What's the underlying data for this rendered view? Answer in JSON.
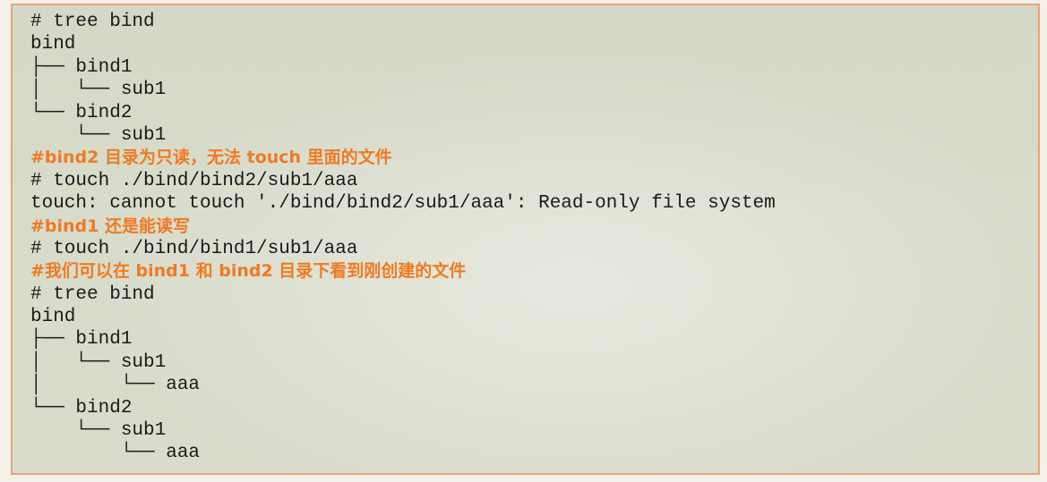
{
  "code_block": {
    "lines": [
      {
        "text": "# tree bind",
        "type": "command"
      },
      {
        "text": "bind",
        "type": "output"
      },
      {
        "text": "├── bind1",
        "type": "output"
      },
      {
        "text": "│   └── sub1",
        "type": "output"
      },
      {
        "text": "└── bind2",
        "type": "output"
      },
      {
        "text": "    └── sub1",
        "type": "output"
      },
      {
        "text": "#bind2 目录为只读，无法 touch 里面的文件",
        "type": "comment"
      },
      {
        "text": "# touch ./bind/bind2/sub1/aaa",
        "type": "command"
      },
      {
        "text": "touch: cannot touch './bind/bind2/sub1/aaa': Read-only file system",
        "type": "output"
      },
      {
        "text": "#bind1 还是能读写",
        "type": "comment"
      },
      {
        "text": "# touch ./bind/bind1/sub1/aaa",
        "type": "command"
      },
      {
        "text": "#我们可以在 bind1 和 bind2 目录下看到刚创建的文件",
        "type": "comment"
      },
      {
        "text": "# tree bind",
        "type": "command"
      },
      {
        "text": "bind",
        "type": "output"
      },
      {
        "text": "├── bind1",
        "type": "output"
      },
      {
        "text": "│   └── sub1",
        "type": "output"
      },
      {
        "text": "│       └── aaa",
        "type": "output"
      },
      {
        "text": "└── bind2",
        "type": "output"
      },
      {
        "text": "    └── sub1",
        "type": "output"
      },
      {
        "text": "        └── aaa",
        "type": "output"
      }
    ]
  },
  "colors": {
    "text": "#1a1a1a",
    "comment": "#f07a22",
    "border": "#e8a37a",
    "background": "#d6dac8"
  }
}
